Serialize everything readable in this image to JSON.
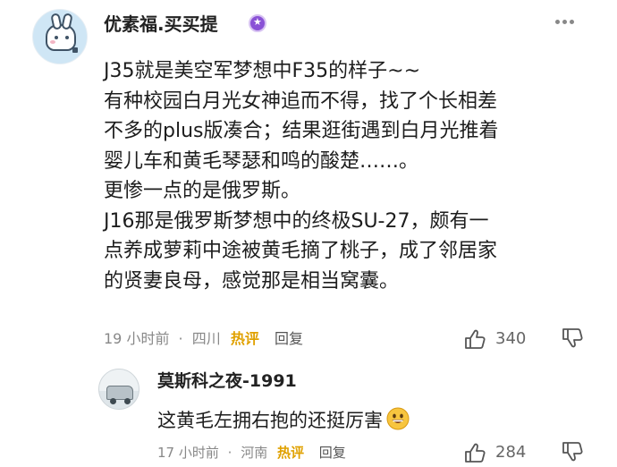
{
  "comment": {
    "username": "优素福.买买提",
    "badge_icon": "vip-star-badge-icon",
    "lines": [
      "J35就是美空军梦想中F35的样子~~",
      "有种校园白月光女神追而不得，找了个长相差",
      "不多的plus版凑合；结果逛街遇到白月光推着",
      "婴儿车和黄毛琴瑟和鸣的酸楚……。",
      "更惨一点的是俄罗斯。",
      "J16那是俄罗斯梦想中的终极SU-27，颇有一",
      "点养成萝莉中途被黄毛摘了桃子，成了邻居家",
      "的贤妻良母，感觉那是相当窝囊。"
    ],
    "meta": {
      "time": "19 小时前",
      "separator": "·",
      "location": "四川",
      "hot_label": "热评",
      "reply_label": "回复"
    },
    "like_count": "340"
  },
  "reply": {
    "username": "莫斯科之夜-1991",
    "text": "这黄毛左拥右抱的还挺厉害",
    "emoji": "grinning-face-emoji",
    "meta": {
      "time": "17 小时前",
      "separator": "·",
      "location": "河南",
      "hot_label": "热评",
      "reply_label": "回复"
    },
    "like_count": "284"
  },
  "colors": {
    "hot_label": "#e0a100",
    "meta_text": "#888888",
    "vip_badge": "#8a52d6"
  }
}
